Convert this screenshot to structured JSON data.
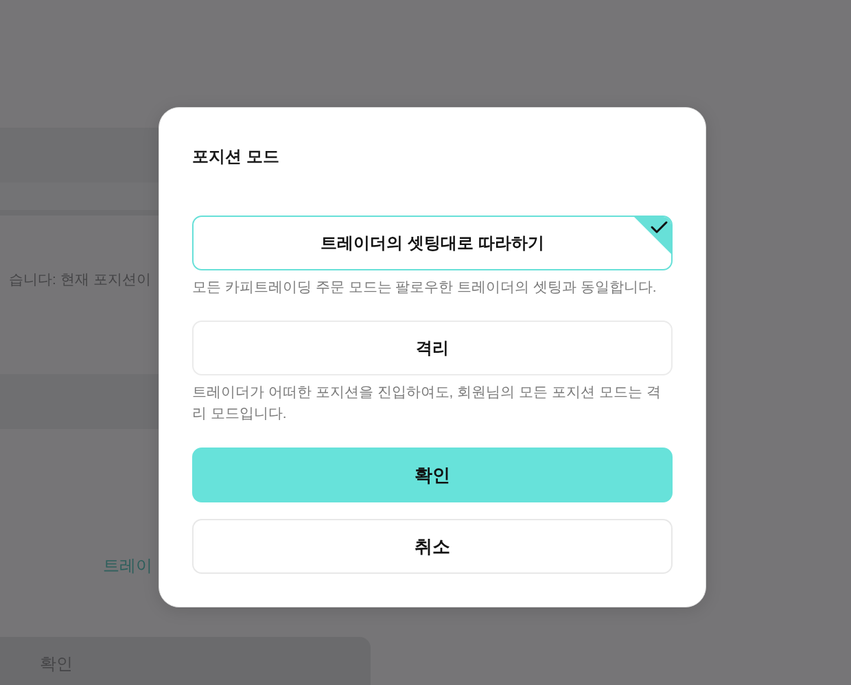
{
  "background": {
    "message": "습니다: 현재 포지션이",
    "link": "트레이",
    "button": "확인"
  },
  "dialog": {
    "title": "포지션 모드",
    "options": [
      {
        "label": "트레이더의 셋팅대로 따라하기",
        "description": "모든 카피트레이딩 주문 모드는 팔로우한 트레이더의 셋팅과 동일합니다.",
        "selected": true
      },
      {
        "label": "격리",
        "description": "트레이더가 어떠한 포지션을 진입하여도, 회원님의 모든 포지션 모드는 격리 모드입니다.",
        "selected": false
      }
    ],
    "buttons": [
      {
        "label": "확인",
        "kind": "primary"
      },
      {
        "label": "취소",
        "kind": "secondary"
      }
    ]
  }
}
